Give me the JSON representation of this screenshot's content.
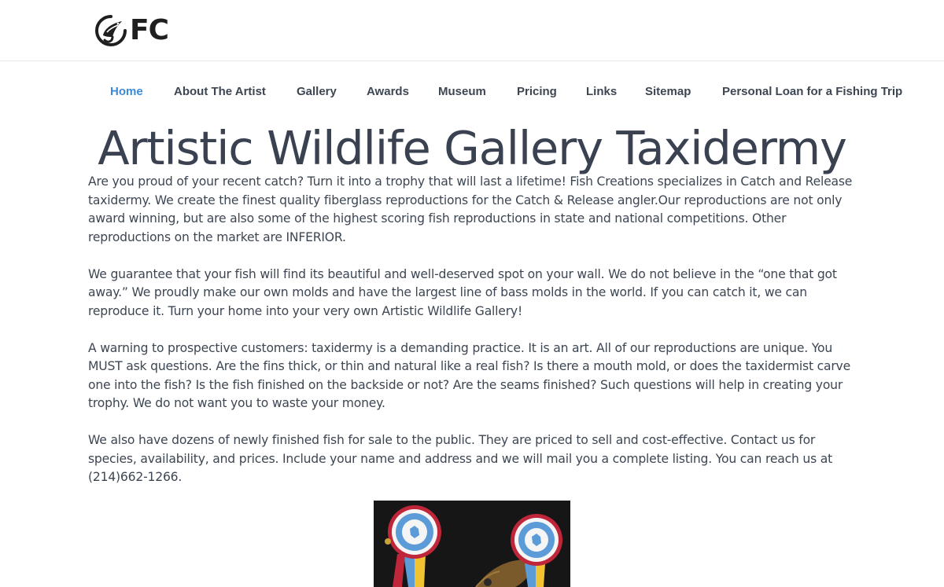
{
  "header": {
    "logo_text": "FC",
    "logo_icon": "fish-hook-circle-icon"
  },
  "nav": {
    "items": [
      {
        "label": "Home",
        "active": true
      },
      {
        "label": "About The Artist",
        "active": false
      },
      {
        "label": "Gallery",
        "active": false
      },
      {
        "label": "Awards",
        "active": false
      },
      {
        "label": "Museum",
        "active": false
      },
      {
        "label": "Pricing",
        "active": false
      },
      {
        "label": "Links",
        "active": false
      },
      {
        "label": "Sitemap",
        "active": false
      },
      {
        "label": "Personal Loan for a Fishing Trip",
        "active": false
      }
    ]
  },
  "main": {
    "title": "Artistic Wildlife Gallery Taxidermy",
    "paragraphs": [
      "Are you proud of your recent catch? Turn it into a trophy that will last a lifetime! Fish Creations specializes in Catch and Release taxidermy. We create the finest quality fiberglass reproductions for the Catch & Release angler.Our reproductions are not only award winning, but are also some of the highest scoring fish reproductions in state and national competitions. Other reproductions on the market are INFERIOR.",
      "We guarantee that your fish will find its beautiful and well-deserved spot on your wall. We do not believe in the “one that got away.” We proudly make our own molds and have the largest line of bass molds in the world. If you can catch it, we can reproduce it. Turn your home into your very own Artistic Wildlife Gallery!",
      "A warning to prospective customers: taxidermy is a demanding practice. It is an art. All of our reproductions are unique. You MUST ask questions. Are the fins thick, or thin and natural like a real fish? Is there a mouth mold, or does the taxidermist carve one into the fish? Is the fish finished on the backside or not? Are the seams finished? Such questions will help in creating your trophy. We do not want you to waste your money.",
      "We also have dozens of newly finished fish for sale to the public. They are priced to sell and cost-effective. Contact us for species, availability, and prices. Include your name and address and we will mail you a complete listing. You can reach us at (214)662-1266."
    ]
  },
  "colors": {
    "accent": "#3b8bd6",
    "text": "#3d4653",
    "ribbon_red": "#c0263a",
    "ribbon_blue": "#5a9bd8",
    "ribbon_yellow": "#f2c330"
  }
}
